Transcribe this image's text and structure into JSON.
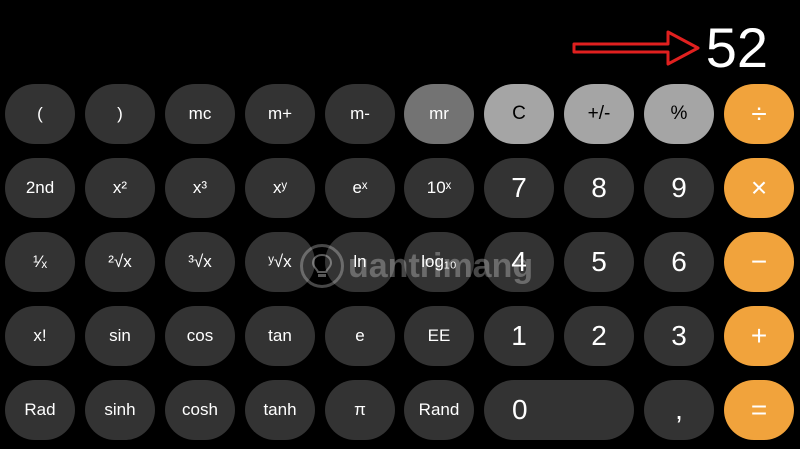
{
  "display": {
    "value": "52"
  },
  "colors": {
    "background": "#000000",
    "scientific_key": "#333333",
    "function_key": "#a5a5a5",
    "operator_key": "#f1a33c",
    "memory_recall_key": "#737373",
    "annotation_arrow": "#e0201f"
  },
  "annotation": {
    "icon": "red-arrow-right-icon"
  },
  "keys": {
    "r1": [
      "(",
      ")",
      "mc",
      "m+",
      "m-",
      "mr",
      "C",
      "+/-",
      "%",
      "÷"
    ],
    "r2": [
      "2nd",
      "x²",
      "x³",
      "xʸ",
      "eˣ",
      "10ˣ",
      "7",
      "8",
      "9",
      "×"
    ],
    "r3": [
      "¹⁄ₓ",
      "²√x",
      "³√x",
      "ʸ√x",
      "ln",
      "log₁₀",
      "4",
      "5",
      "6",
      "−"
    ],
    "r4": [
      "x!",
      "sin",
      "cos",
      "tan",
      "e",
      "EE",
      "1",
      "2",
      "3",
      "+"
    ],
    "r5": [
      "Rad",
      "sinh",
      "cosh",
      "tanh",
      "π",
      "Rand",
      "0",
      ",",
      "="
    ]
  },
  "watermark": {
    "text": "uantrimang",
    "logo": "lightbulb-logo"
  }
}
